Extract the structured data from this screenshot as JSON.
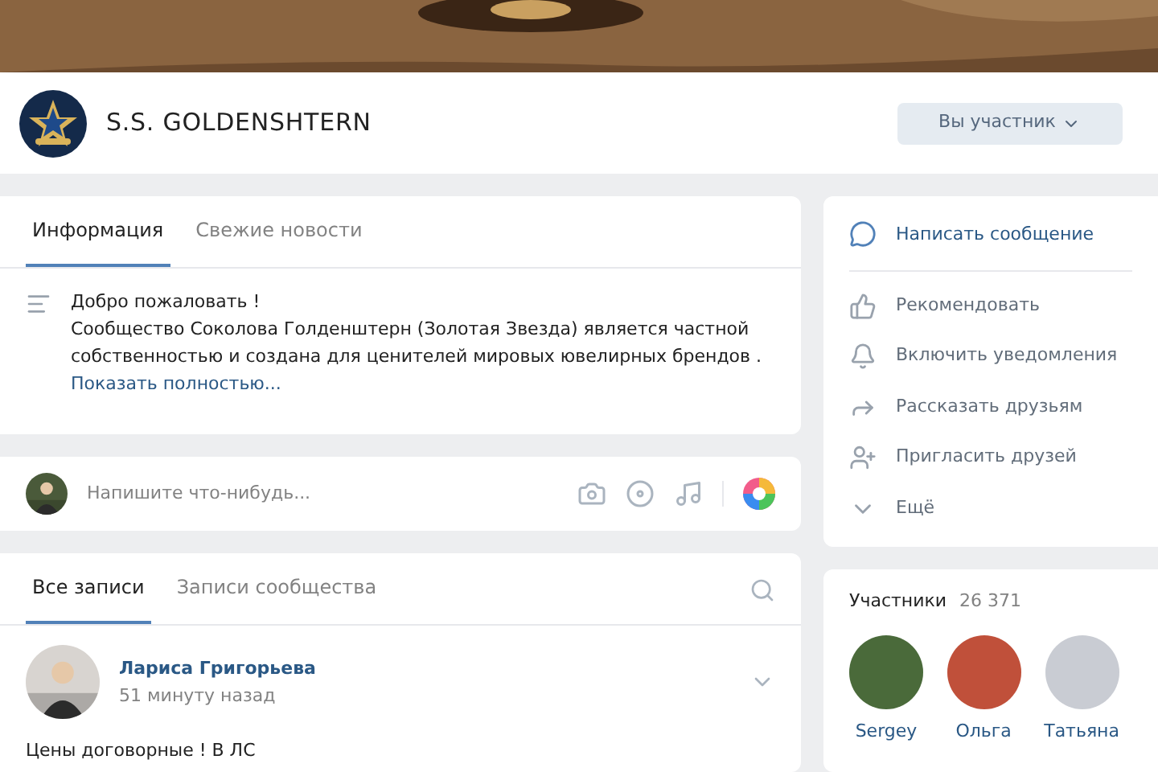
{
  "group": {
    "name": "S.S. GOLDENSHTERN",
    "member_button": "Вы участник"
  },
  "info": {
    "tabs": [
      {
        "label": "Информация",
        "selected": true
      },
      {
        "label": "Свежие новости",
        "selected": false
      }
    ],
    "description": [
      "Добро пожаловать !",
      "Сообщество Соколова Голденштерн (Золотая Звезда) является частной собственностью и создана для ценителей мировых ювелирных брендов ."
    ],
    "show_more": "Показать полностью..."
  },
  "composer": {
    "placeholder": "Напишите что-нибудь..."
  },
  "wall": {
    "tabs": [
      {
        "label": "Все записи",
        "selected": true
      },
      {
        "label": "Записи сообщества",
        "selected": false
      }
    ],
    "post": {
      "author": "Лариса Григорьева",
      "time": "51 минуту назад",
      "text": "Цены договорные ! В ЛС"
    }
  },
  "actions": [
    {
      "kind": "message",
      "label": "Написать сообщение"
    },
    {
      "kind": "like",
      "label": "Рекомендовать"
    },
    {
      "kind": "bell",
      "label": "Включить уведомления"
    },
    {
      "kind": "share",
      "label": "Рассказать друзьям"
    },
    {
      "kind": "invite",
      "label": "Пригласить друзей"
    },
    {
      "kind": "more",
      "label": "Ещё"
    }
  ],
  "members": {
    "title": "Участники",
    "count": "26 371",
    "items": [
      {
        "name": "Sergey",
        "color": "#4a6a3a"
      },
      {
        "name": "Ольга",
        "color": "#c0503a"
      },
      {
        "name": "Татьяна",
        "color": "#c9ccd3"
      }
    ]
  }
}
